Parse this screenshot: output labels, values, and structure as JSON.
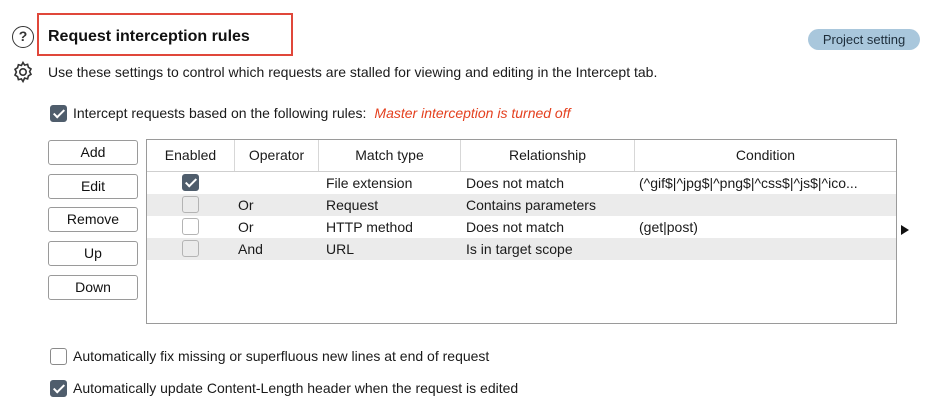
{
  "header": {
    "title": "Request interception rules",
    "badge": "Project setting",
    "description": "Use these settings to control which requests are stalled for viewing and editing in the Intercept tab."
  },
  "intercept": {
    "label": "Intercept requests based on the following rules:",
    "checked": true,
    "warning": "Master interception is turned off"
  },
  "buttons": {
    "add": "Add",
    "edit": "Edit",
    "remove": "Remove",
    "up": "Up",
    "down": "Down"
  },
  "table": {
    "columns": [
      "Enabled",
      "Operator",
      "Match type",
      "Relationship",
      "Condition"
    ],
    "rows": [
      {
        "enabled": true,
        "operator": "",
        "match_type": "File extension",
        "relationship": "Does not match",
        "condition": "(^gif$|^jpg$|^png$|^css$|^js$|^ico..."
      },
      {
        "enabled": false,
        "operator": "Or",
        "match_type": "Request",
        "relationship": "Contains parameters",
        "condition": ""
      },
      {
        "enabled": false,
        "operator": "Or",
        "match_type": "HTTP method",
        "relationship": "Does not match",
        "condition": "(get|post)"
      },
      {
        "enabled": false,
        "operator": "And",
        "match_type": "URL",
        "relationship": "Is in target scope",
        "condition": ""
      }
    ]
  },
  "options": {
    "fix_newlines": {
      "label": "Automatically fix missing or superfluous new lines at end of request",
      "checked": false
    },
    "update_length": {
      "label": "Automatically update Content-Length header when the request is edited",
      "checked": true
    }
  },
  "colors": {
    "highlight_border": "#e0473a",
    "warning_text": "#e4401f",
    "badge_bg": "#a9c7dc",
    "checkbox_checked": "#4f5d6c",
    "row_alt": "#ebebeb"
  }
}
